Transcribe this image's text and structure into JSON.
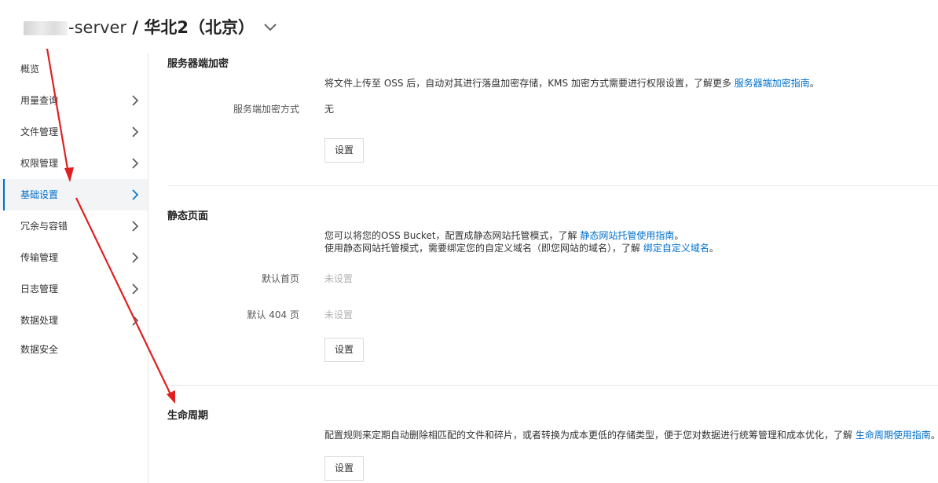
{
  "header": {
    "bucket_name": "-server",
    "separator": " / ",
    "region": "华北2（北京）"
  },
  "sidebar": {
    "items": [
      {
        "label": "概览",
        "has_chevron": false
      },
      {
        "label": "用量查询",
        "has_chevron": true
      },
      {
        "label": "文件管理",
        "has_chevron": true
      },
      {
        "label": "权限管理",
        "has_chevron": true
      },
      {
        "label": "基础设置",
        "has_chevron": true,
        "active": true
      },
      {
        "label": "冗余与容错",
        "has_chevron": true
      },
      {
        "label": "传输管理",
        "has_chevron": true
      },
      {
        "label": "日志管理",
        "has_chevron": true
      },
      {
        "label": "数据处理",
        "has_chevron": true
      },
      {
        "label": "数据安全",
        "has_chevron": false
      }
    ]
  },
  "sections": {
    "encryption": {
      "title": "服务器端加密",
      "desc_text": "将文件上传至 OSS 后，自动对其进行落盘加密存储，KMS 加密方式需要进行权限设置，了解更多 ",
      "desc_link": "服务器端加密指南",
      "desc_end": "。",
      "field_label": "服务端加密方式",
      "field_value": "无",
      "button": "设置"
    },
    "static_page": {
      "title": "静态页面",
      "desc1_text": "您可以将您的OSS Bucket，配置成静态网站托管模式，了解 ",
      "desc1_link": "静态网站托管使用指南",
      "desc1_end": "。",
      "desc2_text": "使用静态网站托管模式，需要绑定您的自定义域名（即您网站的域名），了解 ",
      "desc2_link": "绑定自定义域名",
      "desc2_end": "。",
      "index_label": "默认首页",
      "index_value": "未设置",
      "notfound_label": "默认 404 页",
      "notfound_value": "未设置",
      "button": "设置"
    },
    "lifecycle": {
      "title": "生命周期",
      "desc_text": "配置规则来定期自动删除相匹配的文件和碎片，或者转换为成本更低的存储类型，便于您对数据进行统筹管理和成本优化，了解 ",
      "desc_link": "生命周期使用指南",
      "desc_end": "。",
      "button": "设置"
    }
  },
  "colors": {
    "accent": "#0070cc",
    "annotation": "#e02020",
    "active_bg": "#f2f4f5"
  }
}
